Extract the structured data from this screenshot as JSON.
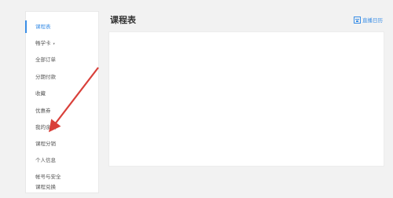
{
  "sidebar": {
    "items": [
      {
        "label": "课程表"
      },
      {
        "label": "畅学卡",
        "caret": "▾"
      },
      {
        "label": "全部订单"
      },
      {
        "label": "分期付款"
      },
      {
        "label": "收藏"
      },
      {
        "label": "优惠券"
      },
      {
        "label": "我的余额"
      },
      {
        "label": "课程分销"
      },
      {
        "label": "个人信息"
      },
      {
        "label": "帐号与安全"
      },
      {
        "label": "课程兑换"
      }
    ]
  },
  "main": {
    "title": "课程表",
    "calendar_link": "直播日历"
  },
  "colors": {
    "accent": "#3a8ee6",
    "arrow": "#d9403a"
  }
}
